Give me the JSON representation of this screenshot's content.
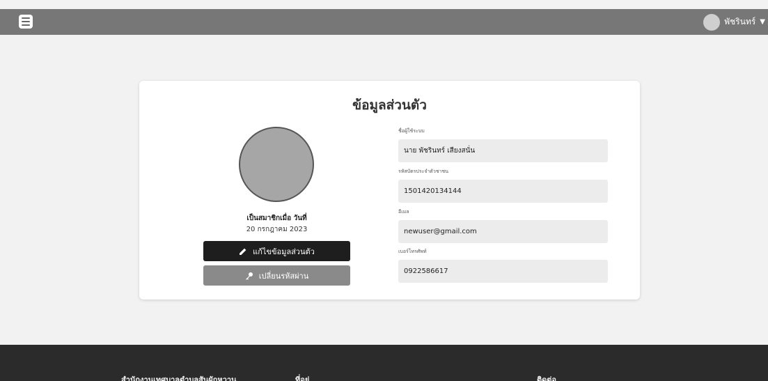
{
  "header": {
    "user_name": "พัชรินทร์"
  },
  "profile": {
    "title": "ข้อมูลส่วนตัว",
    "member_since_label": "เป็นสมาชิกเมื่อ วันที่",
    "member_since_date": "20 กรกฎาคม 2023",
    "edit_button_label": "แก้ไขข้อมูลส่วนตัว",
    "change_password_button_label": "เปลี่ยนรหัสผ่าน",
    "fields": [
      {
        "label": "ชื่อผู้ใช้ระบบ",
        "value": "นาย พัชรินทร์ เสียงสนั่น"
      },
      {
        "label": "รหัสบัตรประจำตัวชาชน",
        "value": "1501420134144"
      },
      {
        "label": "อีเมล",
        "value": "newuser@gmail.com"
      },
      {
        "label": "เบอร์โทรศัพท์",
        "value": "0922586617"
      }
    ]
  },
  "footer": {
    "org_name": "สำนักงานเทศบาลตำบลสันผักหวาน",
    "address_heading": "ที่อยู่",
    "contact_heading": "ติดต่อ"
  },
  "colors": {
    "topbar": "#777777",
    "background": "#f2f2f2",
    "edit_button": "#1e1e1e",
    "password_button": "#8a8a8a",
    "footer": "#2b2b2b"
  },
  "icons": {
    "menu": "hamburger-icon",
    "user": "user-avatar",
    "dropdown": "caret-down-icon",
    "edit": "pencil-icon",
    "password": "key-icon"
  }
}
